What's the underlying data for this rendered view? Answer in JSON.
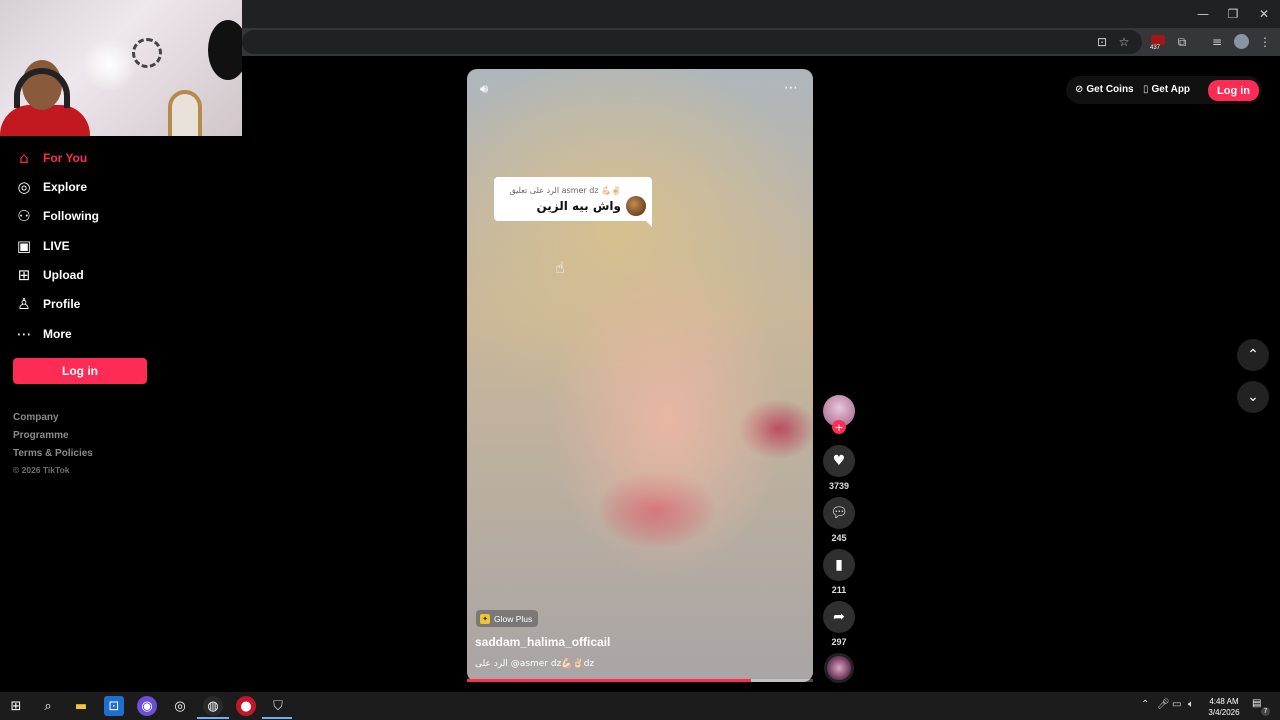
{
  "browser": {
    "window_controls": {
      "minimize": "—",
      "restore": "❐",
      "close": "✕"
    },
    "extension_badge_count": "437"
  },
  "sidebar": {
    "items": [
      {
        "label": "For You",
        "icon": "home-icon"
      },
      {
        "label": "Explore",
        "icon": "compass-icon"
      },
      {
        "label": "Following",
        "icon": "following-icon"
      },
      {
        "label": "LIVE",
        "icon": "live-icon"
      },
      {
        "label": "Upload",
        "icon": "upload-icon"
      },
      {
        "label": "Profile",
        "icon": "profile-icon"
      },
      {
        "label": "More",
        "icon": "more-icon"
      }
    ],
    "login_label": "Log in",
    "footer_links": [
      "Company",
      "Programme",
      "Terms & Policies"
    ],
    "copyright": "© 2026 TikTok"
  },
  "header": {
    "get_coins": "Get Coins",
    "get_app": "Get App",
    "login_label": "Log in"
  },
  "video": {
    "reply_card": {
      "top_text": "الرد على تعليق asmer dz 💪🏻✌🏻",
      "main_text": "واش بيه الزين"
    },
    "effect_label": "Glow Plus",
    "author": "saddam_halima_officail",
    "caption": "الرد على @asmer dz💪🏻✌🏻dz",
    "progress": 0.82
  },
  "actions": {
    "likes": "3739",
    "comments": "245",
    "saves": "211",
    "shares": "297"
  },
  "taskbar": {
    "time": "4:48 AM",
    "date": "3/4/2026",
    "notification_count": "7"
  },
  "colors": {
    "accent": "#fe2c55",
    "background": "#000000"
  }
}
